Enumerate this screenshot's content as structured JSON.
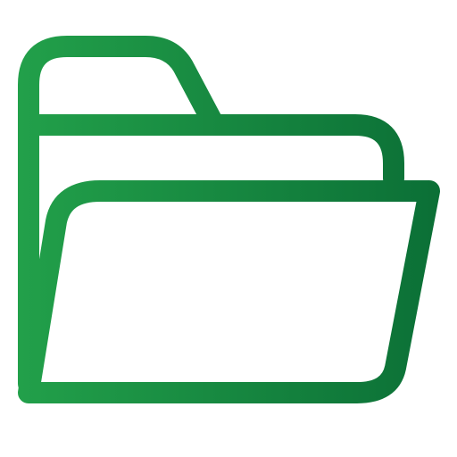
{
  "icon": {
    "name": "open-folder-icon",
    "style": "outline",
    "colors": {
      "gradient_start": "#22a04a",
      "gradient_end": "#0b6f36",
      "background": "#ffffff"
    }
  }
}
